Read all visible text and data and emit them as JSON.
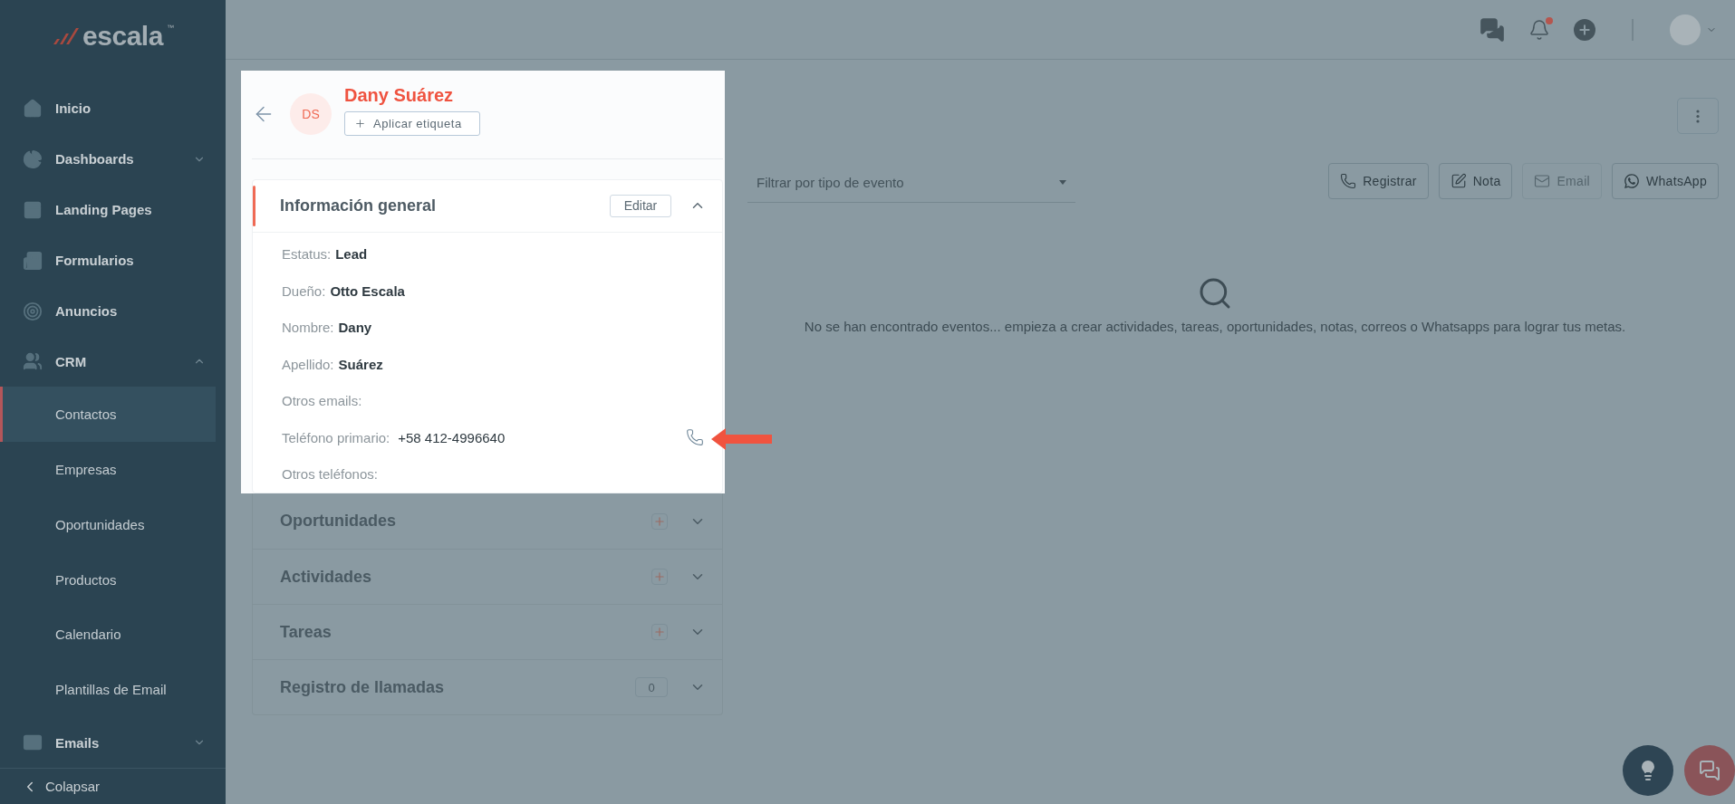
{
  "logo": {
    "text": "escala",
    "trademark": "™"
  },
  "sidebar": {
    "items": [
      {
        "label": "Inicio",
        "selected": false
      },
      {
        "label": "Dashboards",
        "selected": false,
        "expanded": false
      },
      {
        "label": "Landing Pages",
        "selected": false
      },
      {
        "label": "Formularios",
        "selected": false
      },
      {
        "label": "Anuncios",
        "selected": false
      },
      {
        "label": "CRM",
        "selected": false,
        "expanded": true,
        "children": [
          {
            "label": "Contactos",
            "selected": true
          },
          {
            "label": "Empresas",
            "selected": false
          },
          {
            "label": "Oportunidades",
            "selected": false
          },
          {
            "label": "Productos",
            "selected": false
          },
          {
            "label": "Calendario",
            "selected": false
          },
          {
            "label": "Plantillas de Email",
            "selected": false
          }
        ]
      },
      {
        "label": "Emails",
        "selected": false,
        "expanded": false
      }
    ],
    "collapse": "Colapsar"
  },
  "topbar": {
    "notifications_unread": true
  },
  "contact": {
    "initials": "DS",
    "name": "Dany Suárez",
    "tag_button": "Aplicar etiqueta"
  },
  "sections": [
    {
      "kind": "info",
      "title": "Información general",
      "action": "Editar",
      "expanded": true,
      "fields": [
        {
          "label": "Estatus:",
          "value": "Lead"
        },
        {
          "label": "Dueño:",
          "value": "Otto Escala"
        },
        {
          "label": "Nombre:",
          "value": "Dany"
        },
        {
          "label": "Apellido:",
          "value": "Suárez"
        },
        {
          "label": "Otros emails:"
        },
        {
          "label": "Teléfono primario:",
          "value": "+58 412-4996640",
          "kind": "phone"
        },
        {
          "label": "Otros teléfonos:"
        }
      ]
    },
    {
      "kind": "add",
      "title": "Oportunidades",
      "expanded": false
    },
    {
      "kind": "add",
      "title": "Actividades",
      "expanded": false
    },
    {
      "kind": "add",
      "title": "Tareas",
      "expanded": false
    },
    {
      "kind": "count",
      "title": "Registro de llamadas",
      "count": "0",
      "expanded": false
    }
  ],
  "timeline": {
    "filter_placeholder": "Filtrar por tipo de evento",
    "buttons": [
      {
        "label": "Registrar",
        "disabled": false
      },
      {
        "label": "Nota",
        "disabled": false
      },
      {
        "label": "Email",
        "disabled": true
      },
      {
        "label": "WhatsApp",
        "disabled": false
      }
    ],
    "empty_message": "No se han encontrado eventos... empieza a crear actividades, tareas, oportunidades, notas, correos o Whatsapps para lograr tus metas."
  }
}
